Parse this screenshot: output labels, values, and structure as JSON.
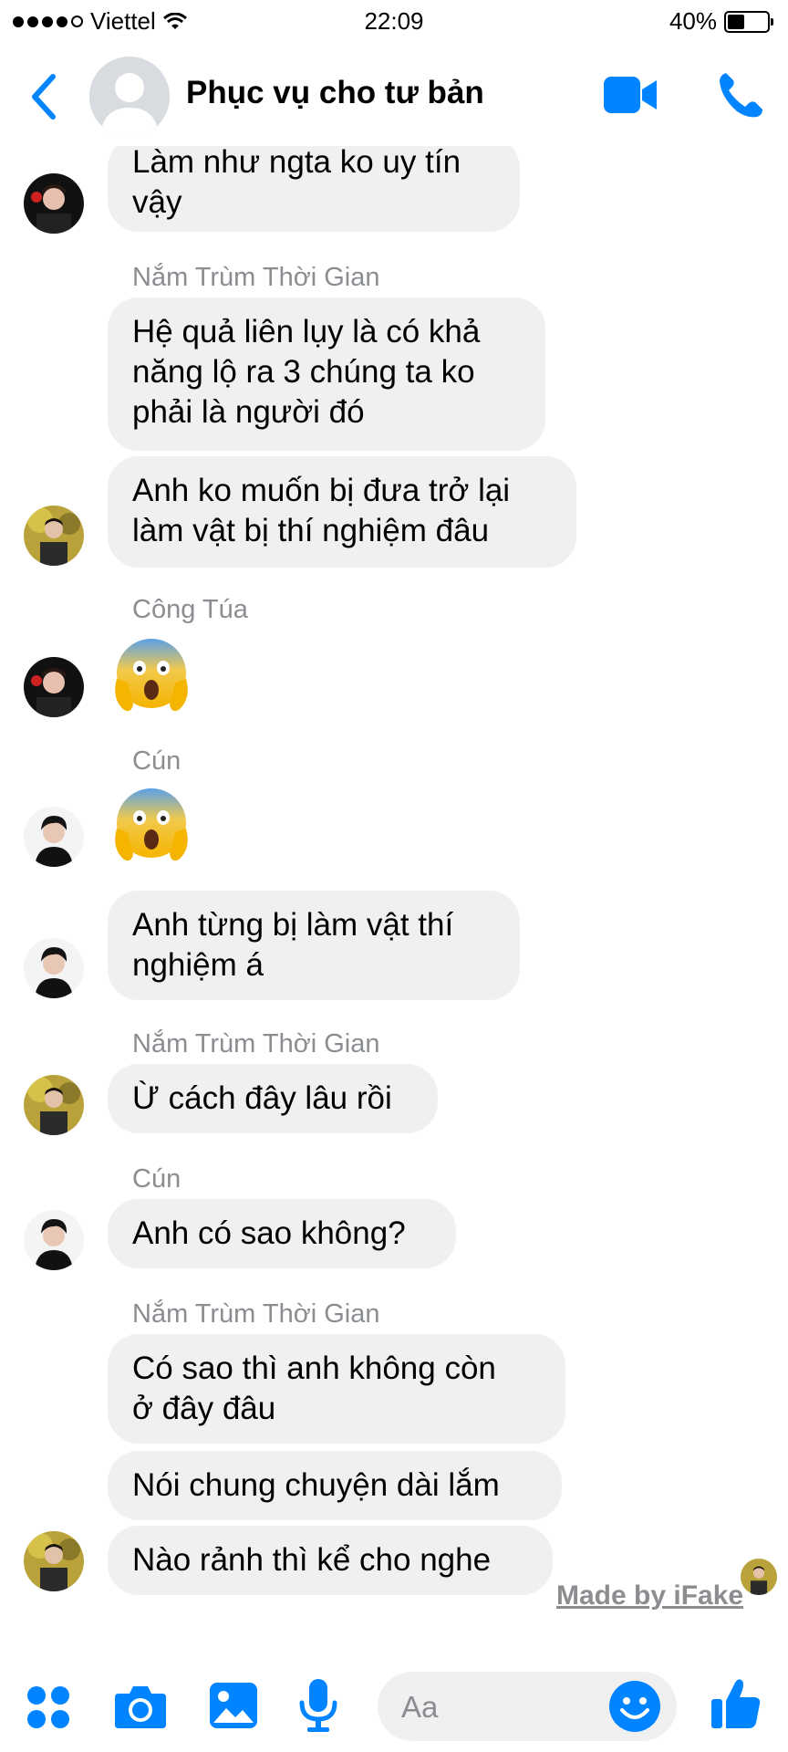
{
  "status_bar": {
    "carrier": "Viettel",
    "time": "22:09",
    "battery": "40%"
  },
  "header": {
    "title": "Phục vụ cho tư bản"
  },
  "messages": {
    "m1": {
      "line1": "Làm như ngta ko uy tín",
      "line2": "vậy"
    },
    "m2_sender": "Nắm Trùm Thời Gian",
    "m2": {
      "line1": "Hệ quả liên lụy là có khả",
      "line2": "năng lộ ra 3 chúng ta ko",
      "line3": "phải là người đó"
    },
    "m3": {
      "line1": "Anh ko muốn bị đưa trở lại",
      "line2": "làm vật bị thí nghiệm đâu"
    },
    "m4_sender": "Công Túa",
    "m5_sender": "Cún",
    "m6": {
      "line1": "Anh từng bị làm vật thí",
      "line2": "nghiệm á"
    },
    "m7_sender": "Nắm Trùm Thời Gian",
    "m7": {
      "line1": "Ừ cách đây lâu rồi"
    },
    "m8_sender": "Cún",
    "m8": {
      "line1": "Anh có sao không?"
    },
    "m9_sender": "Nắm Trùm Thời Gian",
    "m9": {
      "line1": "Có sao thì anh không còn",
      "line2": "ở đây đâu"
    },
    "m10": {
      "line1": "Nói chung chuyện dài lắm"
    },
    "m11": {
      "line1": "Nào rảnh thì kể cho nghe"
    }
  },
  "watermark": "Made by iFake",
  "composer": {
    "placeholder": "Aa"
  },
  "icons": {
    "back": "chevron-left-icon",
    "video": "video-camera-icon",
    "call": "phone-icon",
    "apps": "four-dots-icon",
    "camera": "camera-icon",
    "gallery": "image-icon",
    "mic": "microphone-icon",
    "emoji": "smiley-icon",
    "like": "thumbs-up-icon"
  },
  "colors": {
    "accent": "#0084ff",
    "bubble": "#f0f0f0",
    "secondary_text": "#8a8d91"
  }
}
